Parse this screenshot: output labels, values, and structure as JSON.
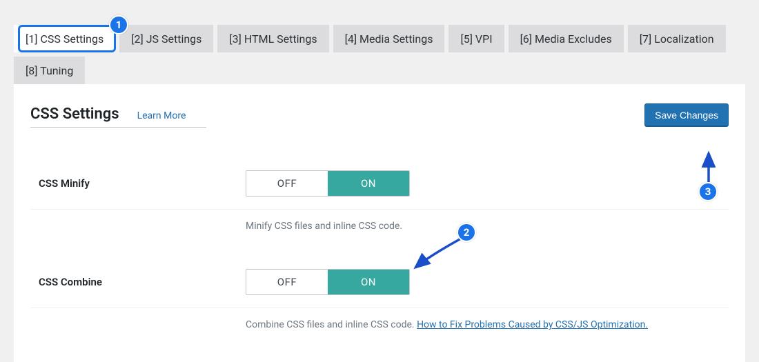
{
  "tabs": {
    "t1": "[1] CSS Settings",
    "t2": "[2] JS Settings",
    "t3": "[3] HTML Settings",
    "t4": "[4] Media Settings",
    "t5": "[5] VPI",
    "t6": "[6] Media Excludes",
    "t7": "[7] Localization",
    "t8": "[8] Tuning"
  },
  "heading": {
    "title": "CSS Settings",
    "learn_more": "Learn More",
    "save": "Save Changes"
  },
  "toggle": {
    "off": "OFF",
    "on": "ON"
  },
  "settings": {
    "css_minify": {
      "label": "CSS Minify",
      "desc": "Minify CSS files and inline CSS code.",
      "value": "on"
    },
    "css_combine": {
      "label": "CSS Combine",
      "desc_pre": "Combine CSS files and inline CSS code. ",
      "desc_link": "How to Fix Problems Caused by CSS/JS Optimization.",
      "value": "on"
    }
  },
  "annotations": {
    "b1": "1",
    "b2": "2",
    "b3": "3"
  }
}
